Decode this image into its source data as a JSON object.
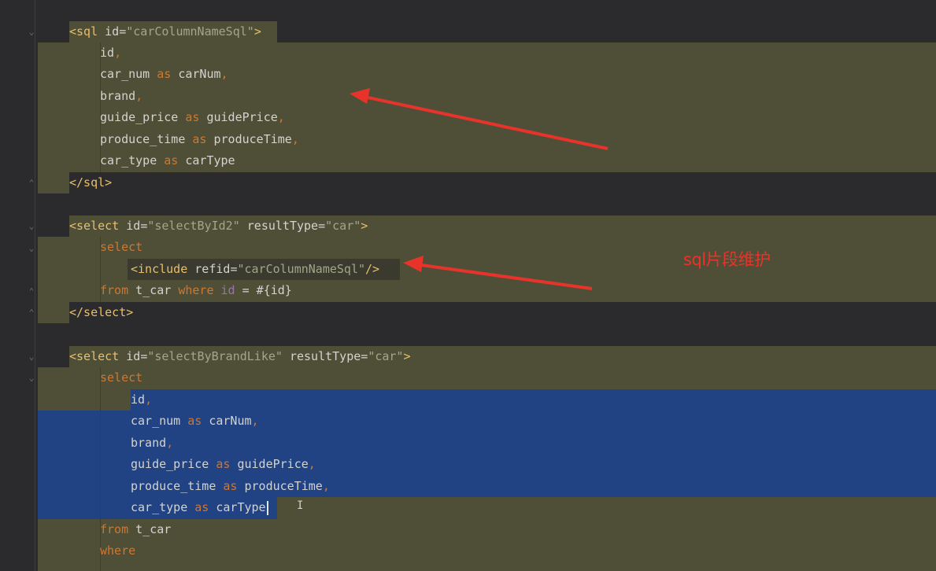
{
  "lines": [
    {
      "id": "l1",
      "tokens": [
        [
          "tag",
          "<sql "
        ],
        [
          "attr",
          "id"
        ],
        [
          "plain",
          "="
        ],
        [
          "str",
          "\"carColumnNameSql\""
        ],
        [
          "tag",
          ">"
        ]
      ]
    },
    {
      "id": "l2",
      "tokens": [
        [
          "ident",
          "id"
        ],
        [
          "kw",
          ","
        ]
      ]
    },
    {
      "id": "l3",
      "tokens": [
        [
          "ident",
          "car_num "
        ],
        [
          "kw",
          "as "
        ],
        [
          "ident",
          "carNum"
        ],
        [
          "kw",
          ","
        ]
      ]
    },
    {
      "id": "l4",
      "tokens": [
        [
          "ident",
          "brand"
        ],
        [
          "kw",
          ","
        ]
      ]
    },
    {
      "id": "l5",
      "tokens": [
        [
          "ident",
          "guide_price "
        ],
        [
          "kw",
          "as "
        ],
        [
          "ident",
          "guidePrice"
        ],
        [
          "kw",
          ","
        ]
      ]
    },
    {
      "id": "l6",
      "tokens": [
        [
          "ident",
          "produce_time "
        ],
        [
          "kw",
          "as "
        ],
        [
          "ident",
          "produceTime"
        ],
        [
          "kw",
          ","
        ]
      ]
    },
    {
      "id": "l7",
      "tokens": [
        [
          "ident",
          "car_type "
        ],
        [
          "kw",
          "as "
        ],
        [
          "ident",
          "carType"
        ]
      ]
    },
    {
      "id": "l8",
      "tokens": [
        [
          "tag",
          "</sql>"
        ]
      ]
    },
    {
      "id": "l9",
      "tokens": []
    },
    {
      "id": "l10",
      "tokens": [
        [
          "tag",
          "<select "
        ],
        [
          "attr",
          "id"
        ],
        [
          "plain",
          "="
        ],
        [
          "str",
          "\"selectById2\" "
        ],
        [
          "attr",
          "resultType"
        ],
        [
          "plain",
          "="
        ],
        [
          "str",
          "\"car\""
        ],
        [
          "tag",
          ">"
        ]
      ]
    },
    {
      "id": "l11",
      "tokens": [
        [
          "kw",
          "select"
        ]
      ]
    },
    {
      "id": "l12",
      "tokens": [
        [
          "tag",
          "<include "
        ],
        [
          "attr",
          "refid"
        ],
        [
          "plain",
          "="
        ],
        [
          "str",
          "\"carColumnNameSql\""
        ],
        [
          "tag",
          "/>"
        ]
      ]
    },
    {
      "id": "l13",
      "tokens": [
        [
          "kw",
          "from "
        ],
        [
          "ident",
          "t_car "
        ],
        [
          "kw",
          "where "
        ],
        [
          "var",
          "id "
        ],
        [
          "plain",
          "= #{id}"
        ]
      ]
    },
    {
      "id": "l14",
      "tokens": [
        [
          "tag",
          "</select>"
        ]
      ]
    },
    {
      "id": "l15",
      "tokens": []
    },
    {
      "id": "l16",
      "tokens": [
        [
          "tag",
          "<select "
        ],
        [
          "attr",
          "id"
        ],
        [
          "plain",
          "="
        ],
        [
          "str",
          "\"selectByBrandLike\" "
        ],
        [
          "attr",
          "resultType"
        ],
        [
          "plain",
          "="
        ],
        [
          "str",
          "\"car\""
        ],
        [
          "tag",
          ">"
        ]
      ]
    },
    {
      "id": "l17",
      "tokens": [
        [
          "kw",
          "select"
        ]
      ]
    },
    {
      "id": "l18",
      "tokens": [
        [
          "ident",
          "id"
        ],
        [
          "kw",
          ","
        ]
      ]
    },
    {
      "id": "l19",
      "tokens": [
        [
          "ident",
          "car_num "
        ],
        [
          "kw",
          "as "
        ],
        [
          "ident",
          "carNum"
        ],
        [
          "kw",
          ","
        ]
      ]
    },
    {
      "id": "l20",
      "tokens": [
        [
          "ident",
          "brand"
        ],
        [
          "kw",
          ","
        ]
      ]
    },
    {
      "id": "l21",
      "tokens": [
        [
          "ident",
          "guide_price "
        ],
        [
          "kw",
          "as "
        ],
        [
          "ident",
          "guidePrice"
        ],
        [
          "kw",
          ","
        ]
      ]
    },
    {
      "id": "l22",
      "tokens": [
        [
          "ident",
          "produce_time "
        ],
        [
          "kw",
          "as "
        ],
        [
          "ident",
          "produceTime"
        ],
        [
          "kw",
          ","
        ]
      ]
    },
    {
      "id": "l23",
      "tokens": [
        [
          "ident",
          "car_type "
        ],
        [
          "kw",
          "as "
        ],
        [
          "ident",
          "carType"
        ]
      ]
    },
    {
      "id": "l24",
      "tokens": [
        [
          "kw",
          "from "
        ],
        [
          "ident",
          "t_car"
        ]
      ]
    },
    {
      "id": "l25",
      "tokens": [
        [
          "kw",
          "where"
        ]
      ]
    }
  ],
  "annotation": {
    "note": "sql片段维护"
  },
  "colors": {
    "tag": "#e8bf6a",
    "keyword": "#cc7832",
    "string": "#a5a589",
    "selection": "#214283",
    "highlight": "#4f4f38",
    "arrow": "#e8332b"
  }
}
